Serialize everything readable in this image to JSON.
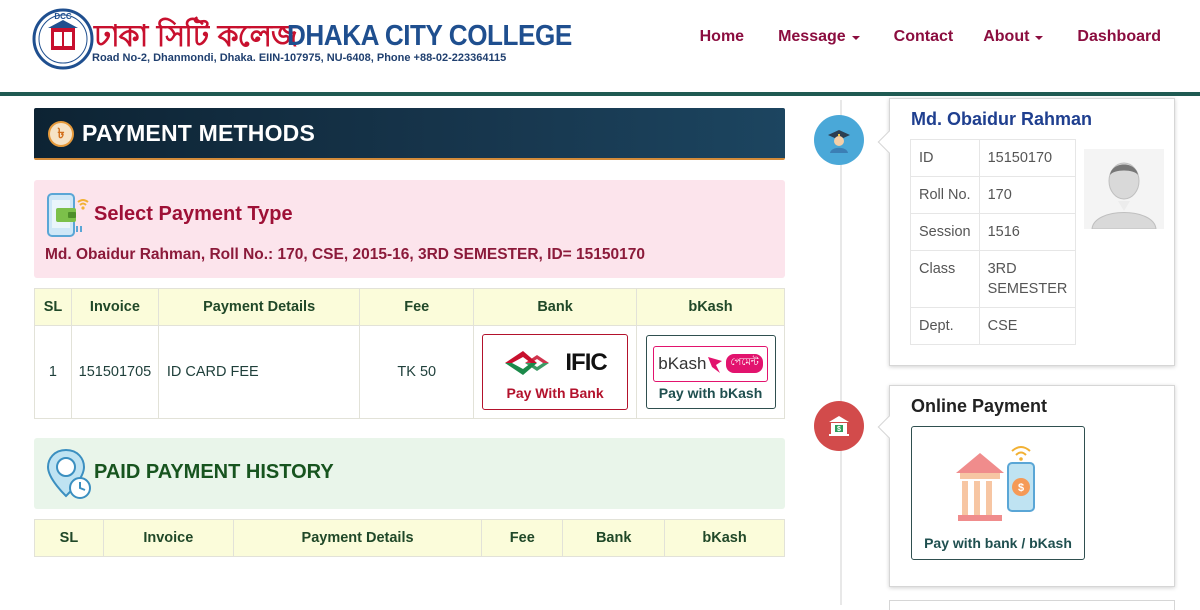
{
  "header": {
    "logo_badge_text": "DCC",
    "logo_bangla": "ঢাকা সিটি কলেজ",
    "logo_english": "DHAKA CITY COLLEGE",
    "logo_address": "Road No-2, Dhanmondi, Dhaka. EIIN-107975, NU-6408, Phone +88-02-223364115",
    "nav": [
      {
        "label": "Home",
        "dropdown": false
      },
      {
        "label": "Message",
        "dropdown": true
      },
      {
        "label": "Contact",
        "dropdown": false
      },
      {
        "label": "About",
        "dropdown": true
      },
      {
        "label": "Dashboard",
        "dropdown": false
      }
    ]
  },
  "payment_methods": {
    "icon_symbol": "৳",
    "title": "PAYMENT METHODS"
  },
  "select_payment": {
    "title": "Select Payment Type",
    "student_info": "Md. Obaidur Rahman, Roll No.: 170, CSE, 2015-16, 3RD SEMESTER, ID= 15150170"
  },
  "payment_table": {
    "headers": [
      "SL",
      "Invoice",
      "Payment Details",
      "Fee",
      "Bank",
      "bKash"
    ],
    "rows": [
      {
        "sl": "1",
        "invoice": "151501705",
        "details": "ID CARD FEE",
        "fee": "TK 50",
        "bank_logo_text": "IFIC",
        "bank_button": "Pay With Bank",
        "bkash_logo_text": "bKash",
        "bkash_logo_bangla": "পেমেন্ট",
        "bkash_button": "Pay with bKash"
      }
    ]
  },
  "history": {
    "title": "PAID PAYMENT HISTORY",
    "headers": [
      "SL",
      "Invoice",
      "Payment Details",
      "Fee",
      "Bank",
      "bKash"
    ]
  },
  "profile_card": {
    "name": "Md. Obaidur Rahman",
    "fields": [
      {
        "label": "ID",
        "value": "15150170"
      },
      {
        "label": "Roll No.",
        "value": "170"
      },
      {
        "label": "Session",
        "value": "1516"
      },
      {
        "label": "Class",
        "value": "3RD SEMESTER"
      },
      {
        "label": "Dept.",
        "value": "CSE"
      }
    ]
  },
  "online_payment": {
    "title": "Online Payment",
    "button": "Pay with bank / bKash"
  },
  "colors": {
    "brand_red": "#8b0d3f",
    "navy_bar": "#0d2333",
    "pink_panel": "#fce4ec",
    "green_panel": "#e9f5ea",
    "table_header": "#fbfcda",
    "timeline_blue": "#4aa8d8",
    "timeline_red": "#d24b4b"
  }
}
